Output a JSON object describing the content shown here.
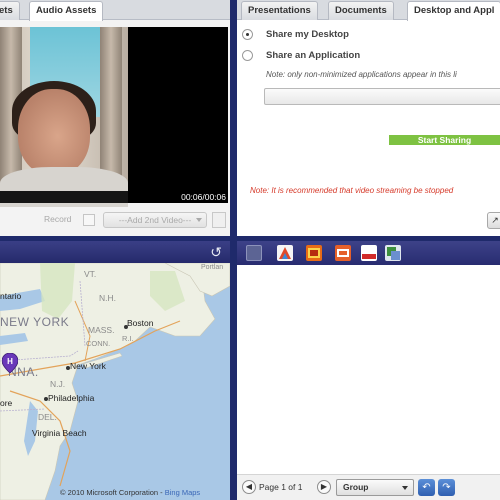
{
  "video_panel": {
    "tabs": [
      {
        "label": "ets",
        "active": false
      },
      {
        "label": "Audio Assets",
        "active": true
      }
    ],
    "timecode": "00:06/00:06",
    "record_label": "Record",
    "add_video_label": "---Add 2nd Video---"
  },
  "share_panel": {
    "tabs": [
      {
        "label": "Presentations",
        "active": false
      },
      {
        "label": "Documents",
        "active": false
      },
      {
        "label": "Desktop and Appl",
        "active": true
      }
    ],
    "option_desktop": "Share my Desktop",
    "option_application": "Share an Application",
    "selected_option": "desktop",
    "note": "Note: only non-minimized applications appear in this li",
    "start_button": "Start Sharing",
    "start_button_color": "#7ec242",
    "warning": "Note: It is recommended that video streaming be stopped",
    "warning_color": "#d63a2a",
    "corner_button_icon": "cursor-icon"
  },
  "map_panel": {
    "refresh_icon": "refresh-icon",
    "labels": {
      "vt": "VT.",
      "nh": "N.H.",
      "toronto": "ntario",
      "newyork_state": "NEW YORK",
      "mass": "MASS.",
      "boston": "Boston",
      "ri": "R.I.",
      "conn": "CONN.",
      "newyork_city": "New York",
      "penn": "NNA.",
      "nj": "N.J.",
      "philadelphia": "Philadelphia",
      "baltimore": "ore",
      "del": "DEL.",
      "virginia_beach": "Virginia Beach",
      "portland": "Portlan"
    },
    "pin_letter": "H",
    "copyright": "© 2010 Microsoft Corporation",
    "bing_label": "Bing Maps"
  },
  "doc_panel": {
    "toolbar_icons": [
      "blank-page-icon",
      "image-tool-icon",
      "film-icon",
      "powerpoint-icon",
      "pdf-icon",
      "excel-icon"
    ],
    "page_label": "Page 1 of 1",
    "group_label": "Group",
    "undo_icon": "undo-icon",
    "redo_icon": "redo-icon"
  }
}
